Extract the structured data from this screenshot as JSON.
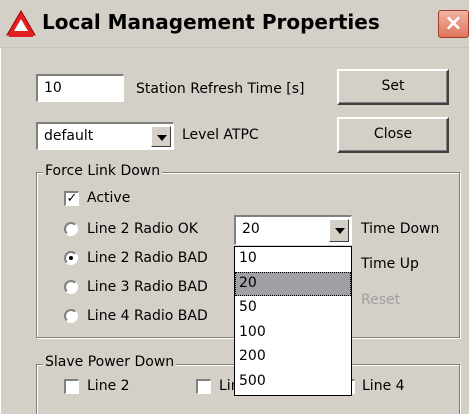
{
  "window": {
    "title": "Local Management Properties",
    "close_glyph": "×"
  },
  "station": {
    "refresh_value": "10",
    "refresh_label": "Station Refresh Time [s]",
    "set_label": "Set"
  },
  "atpc": {
    "level_value": "default",
    "level_label": "Level ATPC",
    "close_label": "Close"
  },
  "force_link_down": {
    "group_label": "Force Link Down",
    "active_label": "Active",
    "active_checked": true,
    "radios": [
      {
        "label": "Line 2 Radio OK",
        "selected": false
      },
      {
        "label": "Line 2 Radio BAD",
        "selected": true
      },
      {
        "label": "Line 3 Radio BAD",
        "selected": false
      },
      {
        "label": "Line 4 Radio BAD",
        "selected": false
      }
    ],
    "time_down_value": "20",
    "time_down_label": "Time Down",
    "time_up_label": "Time Up",
    "reset_label": "Reset",
    "time_options": [
      "10",
      "20",
      "50",
      "100",
      "200",
      "500"
    ],
    "time_selected": "20"
  },
  "slave_power_down": {
    "group_label": "Slave Power Down",
    "lines": [
      "Line 2",
      "Line 3",
      "Line 4"
    ]
  },
  "icons": {
    "app": "red-triangle-logo-icon",
    "close": "close-icon",
    "dropdown": "chevron-down-icon",
    "check": "checkmark-icon"
  },
  "colors": {
    "face": "#d4d0c8",
    "close_button": "#e0735a",
    "list_selection": "#a0a0a4"
  }
}
